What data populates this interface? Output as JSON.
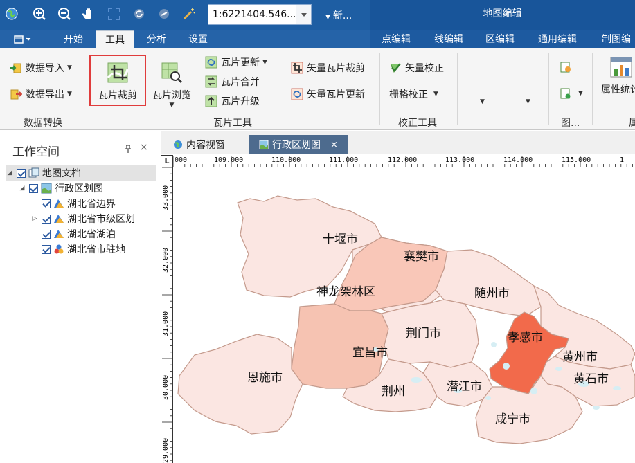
{
  "quickbar": {
    "scale_value": "1:6221404.546...",
    "new_label": "新...",
    "context_title": "地图编辑",
    "colors": {
      "bar": "#1e5ea3",
      "context": "#18559a"
    }
  },
  "tabs": {
    "menu_icon": "menu-icon",
    "items": [
      "开始",
      "工具",
      "分析",
      "设置"
    ],
    "active": "工具",
    "context_items": [
      "点编辑",
      "线编辑",
      "区编辑",
      "通用编辑",
      "制图编"
    ]
  },
  "ribbon": {
    "data_conversion": {
      "import_label": "数据导入",
      "export_label": "数据导出",
      "group_label": "数据转换"
    },
    "tile_tools": {
      "crop_label": "瓦片裁剪",
      "browse_label": "瓦片浏览",
      "update_label": "瓦片更新",
      "merge_label": "瓦片合并",
      "upgrade_label": "瓦片升级",
      "vector_crop_label": "矢量瓦片裁剪",
      "vector_update_label": "矢量瓦片更新",
      "group_label": "瓦片工具"
    },
    "correction": {
      "vector_label": "矢量校正",
      "raster_label": "栅格校正",
      "group_label": "校正工具"
    },
    "misc": {
      "graph_group_label": "图...",
      "attr_stats_label": "属性统计",
      "last_group_label": "属"
    }
  },
  "workspace": {
    "title": "工作空间",
    "pin": "ᵖ",
    "close": "×",
    "tree": [
      {
        "label": "地图文档",
        "level": 0,
        "twisty": "◢",
        "icon": "map-document-icon"
      },
      {
        "label": "行政区划图",
        "level": 1,
        "twisty": "◢",
        "icon": "map-icon"
      },
      {
        "label": "湖北省边界",
        "level": 2,
        "twisty": "",
        "icon": "area-layer-icon"
      },
      {
        "label": "湖北省市级区划",
        "level": 2,
        "twisty": "▷",
        "icon": "area-layer-icon"
      },
      {
        "label": "湖北省湖泊",
        "level": 2,
        "twisty": "",
        "icon": "area-layer-icon"
      },
      {
        "label": "湖北省市驻地",
        "level": 2,
        "twisty": "",
        "icon": "point-layer-icon"
      }
    ]
  },
  "doc_tabs": {
    "content_view": "内容视窗",
    "admin_map": "行政区划图",
    "close": "×"
  },
  "rulers": {
    "corner": "L",
    "h_labels": [
      "000",
      "109.000",
      "110.000",
      "111.000",
      "112.000",
      "113.000",
      "114.000",
      "115.000",
      "1"
    ],
    "v_labels": [
      "33.000",
      "32.000",
      "31.000",
      "30.000",
      "29.000"
    ]
  },
  "map": {
    "cities": [
      {
        "name": "十堰市",
        "fill": "#fbe6e2"
      },
      {
        "name": "襄樊市",
        "fill": "#fbe6e2"
      },
      {
        "name": "神龙架林区",
        "fill": "#f9c7b8"
      },
      {
        "name": "随州市",
        "fill": "#fbe6e2"
      },
      {
        "name": "荆门市",
        "fill": "#fbe6e2"
      },
      {
        "name": "孝感市",
        "fill": "#f26a4b"
      },
      {
        "name": "宜昌市",
        "fill": "#f6c3b2"
      },
      {
        "name": "恩施市",
        "fill": "#fbe6e2"
      },
      {
        "name": "黄州市",
        "fill": "#fbe6e2"
      },
      {
        "name": "荆州",
        "fill": "#fbe6e2"
      },
      {
        "name": "潜江市",
        "fill": "#fbe6e2"
      },
      {
        "name": "黄石市",
        "fill": "#fbe6e2"
      },
      {
        "name": "咸宁市",
        "fill": "#fbe6e2"
      }
    ]
  }
}
